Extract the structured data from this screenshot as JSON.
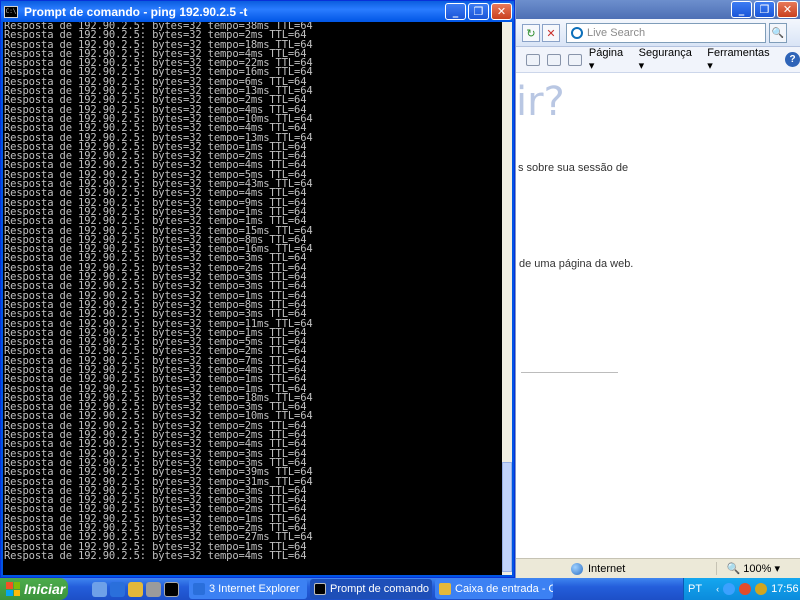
{
  "ie": {
    "search_placeholder": "Live Search",
    "menu": [
      "Página ▾",
      "Segurança ▾",
      "Ferramentas ▾"
    ],
    "content_question_fragment": "ir?",
    "text_line_1": "s sobre sua sessão de",
    "text_line_2": "de uma página da web.",
    "status_zone": "Internet",
    "status_zoom": "100%"
  },
  "cmd": {
    "title": "Prompt de comando - ping 192.90.2.5 -t",
    "ip": "192.90.2.5",
    "prefix": "Resposta de",
    "times": [
      38,
      2,
      18,
      4,
      22,
      16,
      6,
      13,
      2,
      4,
      10,
      4,
      13,
      1,
      2,
      4,
      5,
      43,
      4,
      9,
      1,
      1,
      15,
      8,
      16,
      3,
      2,
      3,
      3,
      1,
      8,
      3,
      11,
      1,
      5,
      2,
      7,
      4,
      1,
      1,
      18,
      3,
      10,
      2,
      2,
      4,
      3,
      3,
      39,
      31,
      3,
      3,
      2,
      1,
      2,
      27,
      1,
      4
    ],
    "bytes": "32",
    "ttl": "64"
  },
  "taskbar": {
    "start_label": "Iniciar",
    "tasks": [
      {
        "label": "3 Internet Explorer",
        "color": "#2a6fdb"
      },
      {
        "label": "Prompt de comando -...",
        "color": "#000000"
      },
      {
        "label": "Caixa de entrada - O...",
        "color": "#e4b83a"
      }
    ],
    "language": "PT",
    "clock": "17:56"
  }
}
